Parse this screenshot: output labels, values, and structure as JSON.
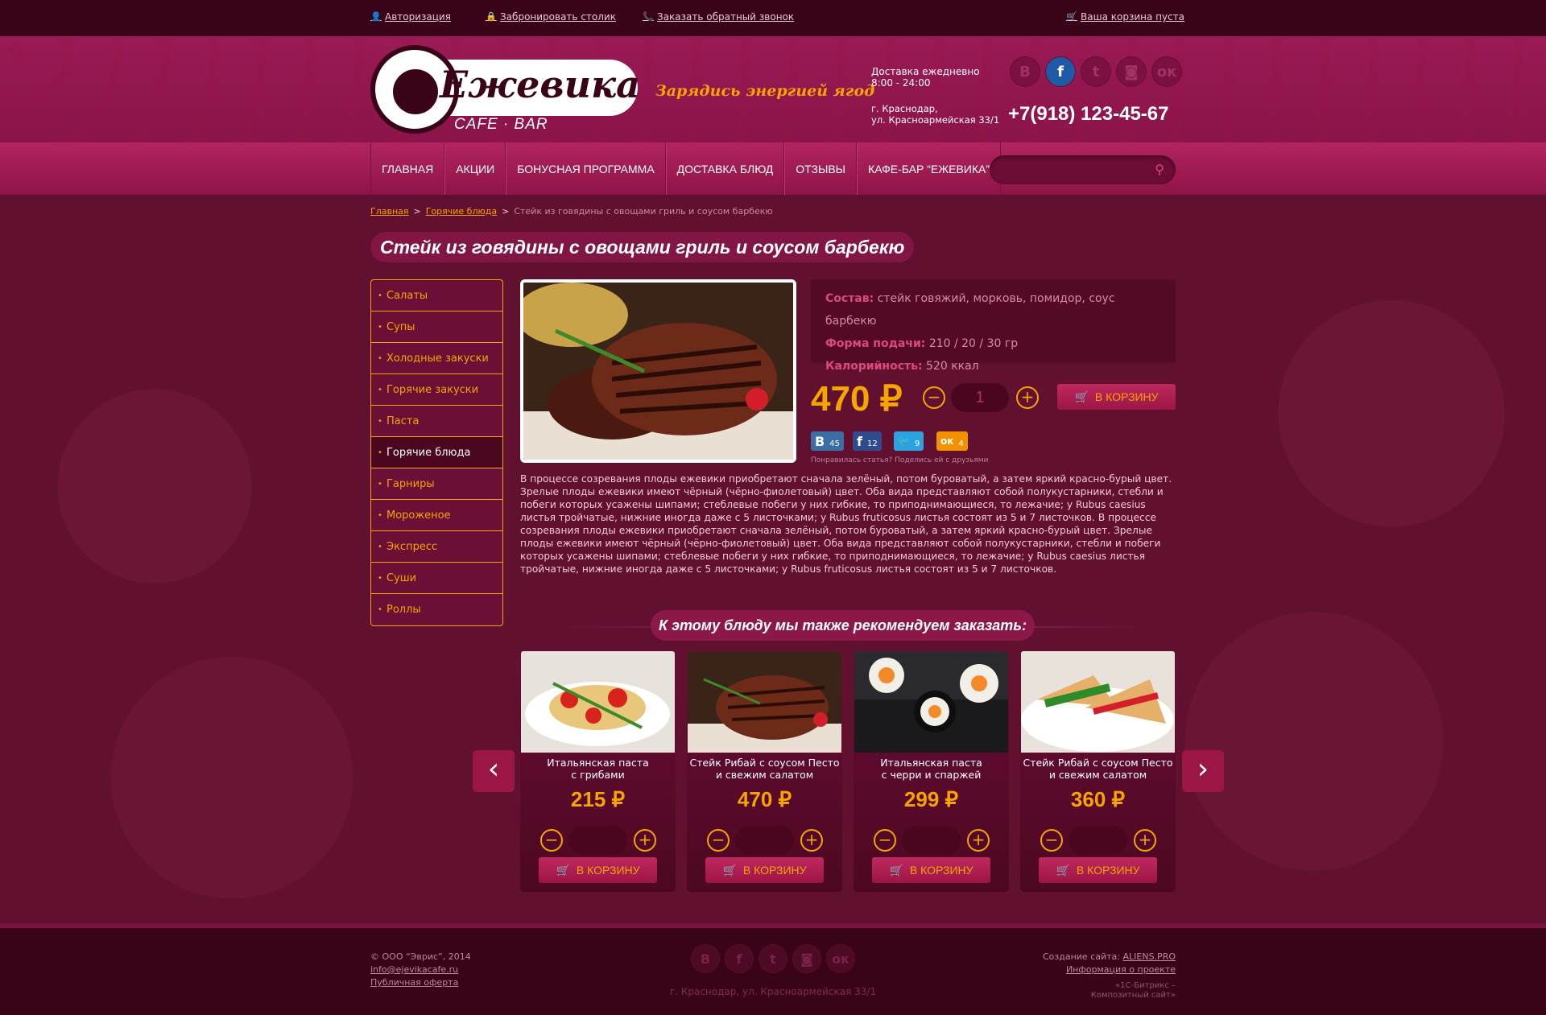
{
  "topbar": {
    "auth": "Авторизация",
    "reserve": "Забронировать столик",
    "callback": "Заказать обратный звонок",
    "cart": "Ваша корзина пуста"
  },
  "header": {
    "logo_name": "Ежевика",
    "logo_sub": "CAFE · BAR",
    "slogan": "Зарядись энергией ягод",
    "delivery_line1": "Доставка ежедневно",
    "delivery_line2": "8:00 - 24:00",
    "address_line1": "г. Краснодар,",
    "address_line2": "ул. Красноармейская 33/1",
    "phone": "+7(918) 123-45-67",
    "social": [
      "vk-icon",
      "facebook-icon",
      "twitter-icon",
      "instagram-icon",
      "odnoklassniki-icon"
    ],
    "social_active": "facebook-icon"
  },
  "nav": {
    "items": [
      "ГЛАВНАЯ",
      "АКЦИИ",
      "БОНУСНАЯ ПРОГРАММА",
      "ДОСТАВКА БЛЮД",
      "ОТЗЫВЫ",
      "КАФЕ-БАР “ЕЖЕВИКА”"
    ],
    "search_placeholder": ""
  },
  "breadcrumbs": {
    "items": [
      "Главная",
      "Горячие блюда"
    ],
    "current": "Стейк из говядины с овощами гриль и соусом барбекю"
  },
  "product": {
    "title": "Стейк из говядины с овощами гриль и соусом барбекю",
    "composition_label": "Состав:",
    "composition": "стейк говяжий, морковь, помидор, соус барбекю",
    "serving_label": "Форма подачи:",
    "serving": "210 / 20 / 30 гр",
    "calories_label": "Калорийность:",
    "calories": "520 ккал",
    "price": "470 ₽",
    "qty": "1",
    "cart_label": "В КОРЗИНУ",
    "share": [
      {
        "network": "vk-icon",
        "glyph": "В",
        "count": "45",
        "color": "#3a6ea5"
      },
      {
        "network": "facebook-icon",
        "glyph": "f",
        "count": "12",
        "color": "#2f4b8c"
      },
      {
        "network": "twitter-icon",
        "glyph": "🐦",
        "count": "9",
        "color": "#2aa3e0"
      },
      {
        "network": "odnoklassniki-icon",
        "glyph": "ок",
        "count": "4",
        "color": "#f39200"
      }
    ],
    "share_text": "Понравилась статья? Поделись ей с друзьями",
    "description": "В процессе созревания плоды ежевики приобретают сначала зелёный, потом буроватый, а затем яркий красно-бурый цвет. Зрелые плоды ежевики имеют чёрный (чёрно-фиолетовый) цвет. Оба вида представляют собой полукустарники, стебли и побеги которых усажены шипами; стеблевые побеги у них гибкие, то приподнимающиеся, то лежачие; у Rubus caesius листья тройчатые, нижние иногда даже с 5 листочками; у Rubus fruticosus листья состоят из 5 и 7 листочков. В процессе созревания плоды ежевики приобретают сначала зелёный, потом буроватый, а затем яркий красно-бурый цвет. Зрелые плоды ежевики имеют чёрный (чёрно-фиолетовый) цвет. Оба вида представляют собой полукустарники, стебли и побеги которых усажены шипами; стеблевые побеги у них гибкие, то приподнимающиеся, то лежачие; у Rubus caesius листья тройчатые, нижние иногда даже с 5 листочками; у Rubus fruticosus листья состоят из 5 и 7 листочков."
  },
  "sidebar": {
    "items": [
      "Салаты",
      "Супы",
      "Холодные закуски",
      "Горячие закуски",
      "Паста",
      "Горячие блюда",
      "Гарниры",
      "Мороженое",
      "Экспресс",
      "Суши",
      "Роллы"
    ],
    "active": "Горячие блюда"
  },
  "recommend": {
    "title": "К этому блюду мы также рекомендуем заказать:",
    "items": [
      {
        "name_line1": "Итальянская паста",
        "name_line2": "с грибами",
        "price": "215 ₽",
        "cart_label": "В КОРЗИНУ"
      },
      {
        "name_line1": "Стейк Рибай с соусом Песто",
        "name_line2": "и свежим салатом",
        "price": "470 ₽",
        "cart_label": "В КОРЗИНУ"
      },
      {
        "name_line1": "Итальянская паста",
        "name_line2": "с черри и спаржей",
        "price": "299 ₽",
        "cart_label": "В КОРЗИНУ"
      },
      {
        "name_line1": "Стейк Рибай с соусом Песто",
        "name_line2": "и свежим салатом",
        "price": "360 ₽",
        "cart_label": "В КОРЗИНУ"
      }
    ]
  },
  "footer": {
    "copyright": "© ООО “Эврис”, 2014",
    "email": "info@ejevikacafe.ru",
    "offer": "Публичная оферта",
    "address": "г. Краснодар, ул. Красноармейская 33/1",
    "created_label": "Создание сайта:",
    "created_by": "ALIENS.PRO",
    "project_info": "Информация о проекте",
    "bitrix_line1": "«1С-Битрикс –",
    "bitrix_line2": "Композитный сайт»"
  },
  "colors": {
    "accent": "#f5a500",
    "brand": "#8a1449",
    "dark": "#3a0418"
  }
}
